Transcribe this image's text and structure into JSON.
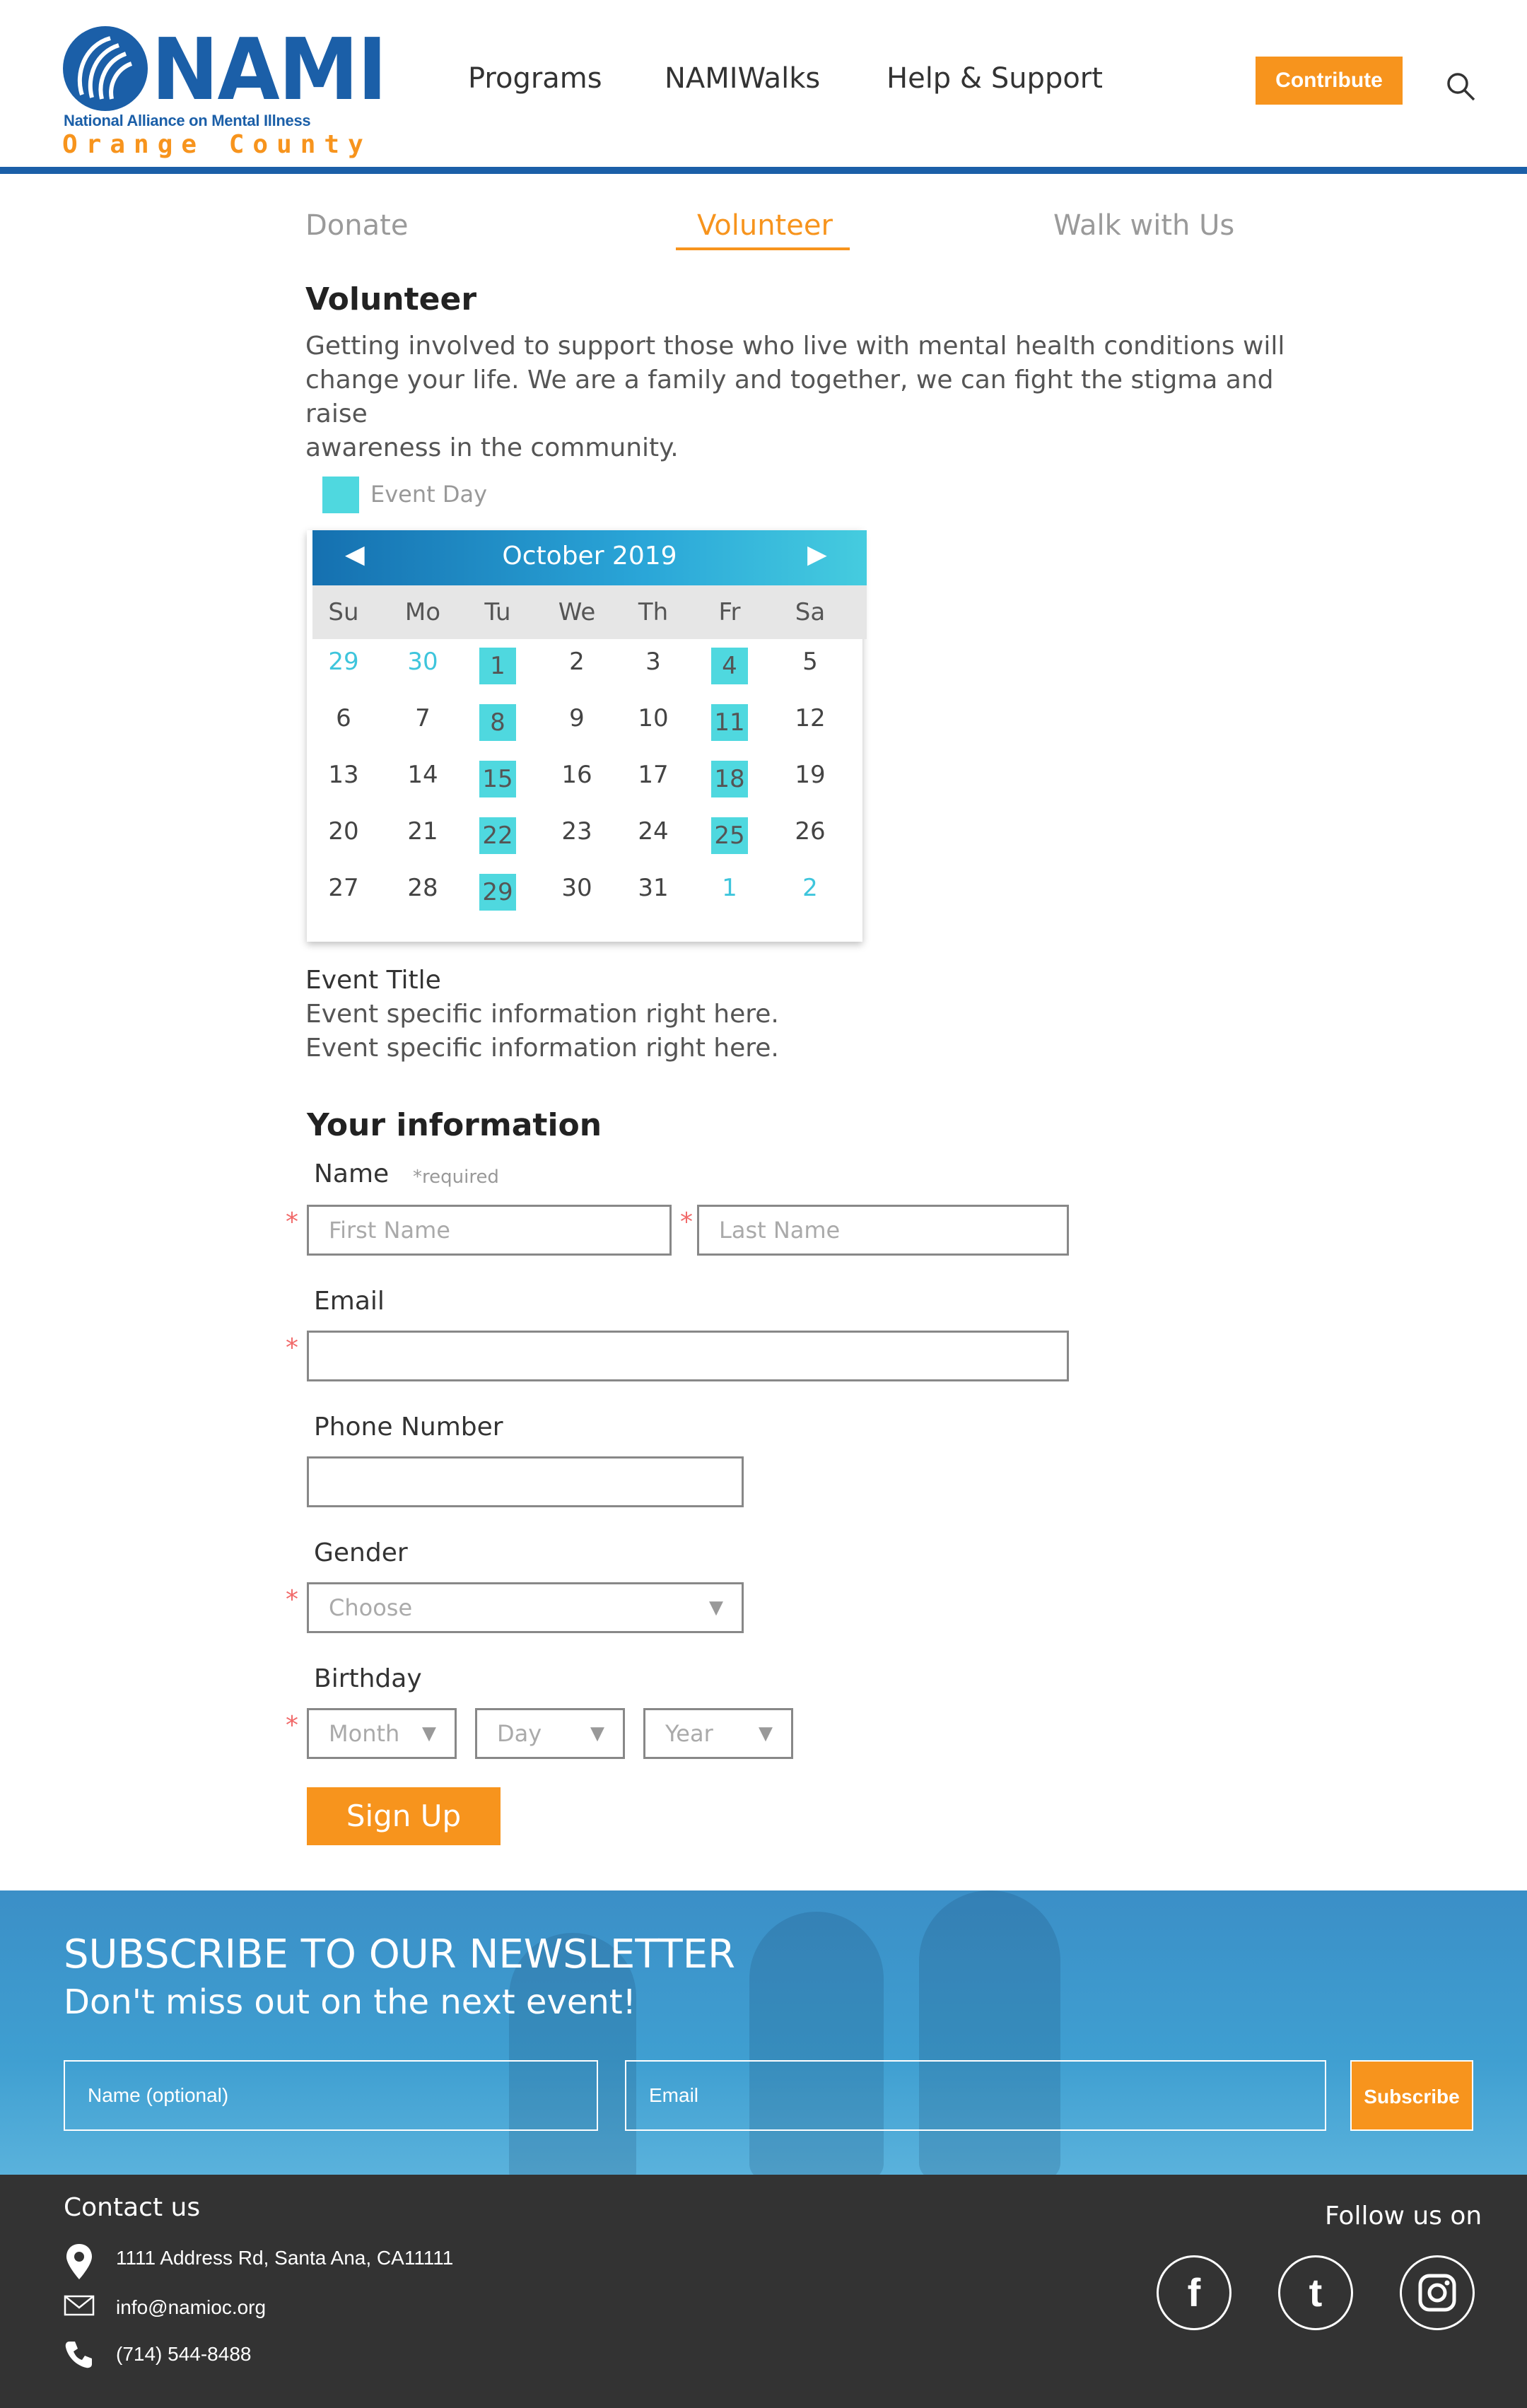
{
  "brand": {
    "name": "NAMI",
    "subtitle": "National Alliance on Mental Illness",
    "region": "Orange County",
    "primary_color": "#1b5fa8",
    "accent_color": "#f7941d",
    "event_color": "#4fd8df"
  },
  "nav": {
    "items": [
      {
        "label": "Programs"
      },
      {
        "label": "NAMIWalks"
      },
      {
        "label": "Help & Support"
      }
    ],
    "contribute_label": "Contribute",
    "search_icon": "search-icon"
  },
  "tabs": [
    {
      "label": "Donate",
      "active": false
    },
    {
      "label": "Volunteer",
      "active": true
    },
    {
      "label": "Walk with Us",
      "active": false
    }
  ],
  "volunteer": {
    "heading": "Volunteer",
    "intro_lines": [
      "Getting involved to support those who live with mental health conditions will",
      "change your life.  We are a family and together, we can fight the stigma and raise",
      "awareness in the community."
    ]
  },
  "legend": {
    "label": "Event Day"
  },
  "calendar": {
    "title": "October 2019",
    "prev_icon": "chevron-left-icon",
    "next_icon": "chevron-right-icon",
    "weekdays": [
      "Su",
      "Mo",
      "Tu",
      "We",
      "Th",
      "Fr",
      "Sa"
    ],
    "weeks": [
      [
        {
          "d": "29",
          "m": true
        },
        {
          "d": "30",
          "m": true
        },
        {
          "d": "1",
          "e": true
        },
        {
          "d": "2"
        },
        {
          "d": "3"
        },
        {
          "d": "4",
          "e": true
        },
        {
          "d": "5"
        }
      ],
      [
        {
          "d": "6"
        },
        {
          "d": "7"
        },
        {
          "d": "8",
          "e": true
        },
        {
          "d": "9"
        },
        {
          "d": "10"
        },
        {
          "d": "11",
          "e": true
        },
        {
          "d": "12"
        }
      ],
      [
        {
          "d": "13"
        },
        {
          "d": "14"
        },
        {
          "d": "15",
          "e": true
        },
        {
          "d": "16"
        },
        {
          "d": "17"
        },
        {
          "d": "18",
          "e": true
        },
        {
          "d": "19"
        }
      ],
      [
        {
          "d": "20"
        },
        {
          "d": "21"
        },
        {
          "d": "22",
          "e": true
        },
        {
          "d": "23"
        },
        {
          "d": "24"
        },
        {
          "d": "25",
          "e": true
        },
        {
          "d": "26"
        }
      ],
      [
        {
          "d": "27"
        },
        {
          "d": "28"
        },
        {
          "d": "29",
          "e": true
        },
        {
          "d": "30"
        },
        {
          "d": "31"
        },
        {
          "d": "1",
          "m": true
        },
        {
          "d": "2",
          "m": true
        }
      ]
    ]
  },
  "event": {
    "title": "Event Title",
    "info_lines": [
      "Event specific information right here.",
      "Event specific information right here."
    ]
  },
  "form": {
    "heading": "Your information",
    "name_label": "Name",
    "required_note": "*required",
    "first_name_placeholder": "First Name",
    "last_name_placeholder": "Last Name",
    "email_label": "Email",
    "email_value": "",
    "phone_label": "Phone Number",
    "phone_value": "",
    "gender_label": "Gender",
    "gender_value": "Choose",
    "birthday_label": "Birthday",
    "birthday_month": "Month",
    "birthday_day": "Day",
    "birthday_year": "Year",
    "required_mark": "*",
    "submit_label": "Sign Up"
  },
  "newsletter": {
    "title": "SUBSCRIBE TO OUR NEWSLETTER",
    "subtitle": "Don't miss out on the next event!",
    "name_placeholder": "Name (optional)",
    "email_placeholder": "Email",
    "button_label": "Subscribe"
  },
  "footer": {
    "contact_heading": "Contact us",
    "address": "1111 Address Rd, Santa Ana, CA11111",
    "email": "info@namioc.org",
    "phone": "(714) 544-8488",
    "follow_heading": "Follow us on",
    "social": [
      {
        "icon": "facebook-icon",
        "glyph": "f"
      },
      {
        "icon": "tumblr-icon",
        "glyph": "t"
      },
      {
        "icon": "instagram-icon",
        "glyph": ""
      }
    ]
  }
}
